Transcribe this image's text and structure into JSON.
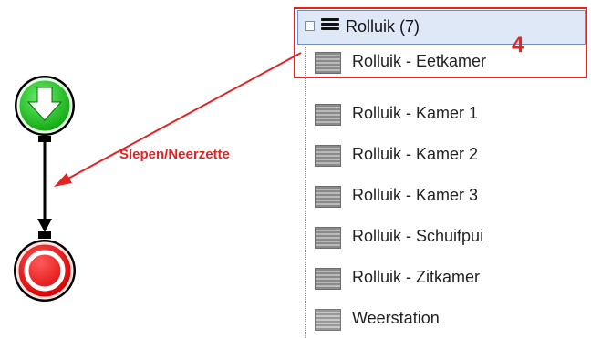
{
  "tree": {
    "group": {
      "label": "Rolluik (7)",
      "icon": "stacked-bars-icon",
      "expanded": true
    },
    "items": [
      {
        "label": "Rolluik - Eetkamer",
        "icon": "shutter-icon"
      },
      {
        "label": "Rolluik - Kamer 1",
        "icon": "shutter-icon"
      },
      {
        "label": "Rolluik - Kamer 2",
        "icon": "shutter-icon"
      },
      {
        "label": "Rolluik - Kamer 3",
        "icon": "shutter-icon"
      },
      {
        "label": "Rolluik - Schuifpui",
        "icon": "shutter-icon"
      },
      {
        "label": "Rolluik - Zitkamer",
        "icon": "shutter-icon"
      },
      {
        "label": "Weerstation",
        "icon": "shutter-icon"
      }
    ]
  },
  "annotations": {
    "step": "4",
    "drag_instruction": "Slepen/Neerzette"
  },
  "flow": {
    "start_icon": "green-down-arrow-icon",
    "end_icon": "red-stop-icon"
  },
  "colors": {
    "accent": "#e32424",
    "start": "#20c020",
    "end": "#e81616",
    "selection": "#dfe8f7"
  }
}
